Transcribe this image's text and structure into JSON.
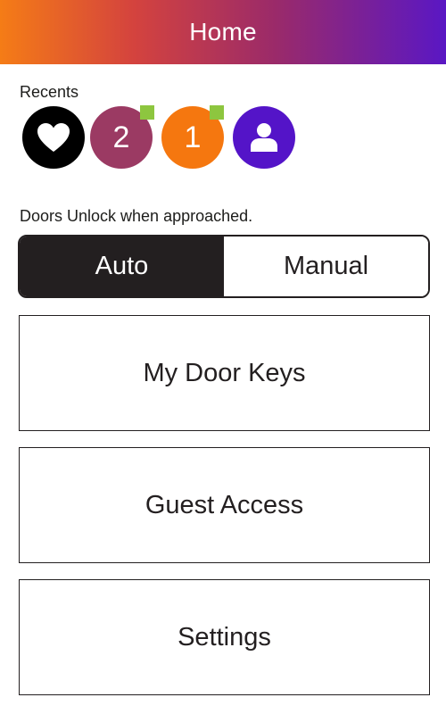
{
  "header": {
    "title": "Home"
  },
  "recents": {
    "label": "Recents",
    "items": [
      {
        "icon": "heart-icon",
        "color": "#000000",
        "text": "",
        "badge": false
      },
      {
        "icon": "",
        "color": "#9b3a63",
        "text": "2",
        "badge": true
      },
      {
        "icon": "",
        "color": "#f5770f",
        "text": "1",
        "badge": true
      },
      {
        "icon": "user-icon",
        "color": "#5414c8",
        "text": "",
        "badge": false
      }
    ],
    "badge_color": "#8dc63f"
  },
  "unlock_hint": "Doors Unlock when approached.",
  "mode_toggle": {
    "options": [
      "Auto",
      "Manual"
    ],
    "selected": "Auto"
  },
  "menu": {
    "my_door_keys": "My Door Keys",
    "guest_access": "Guest Access",
    "settings": "Settings"
  },
  "colors": {
    "header_gradient_start": "#f57c16",
    "header_gradient_end": "#5a17c4",
    "dark": "#231f20"
  }
}
